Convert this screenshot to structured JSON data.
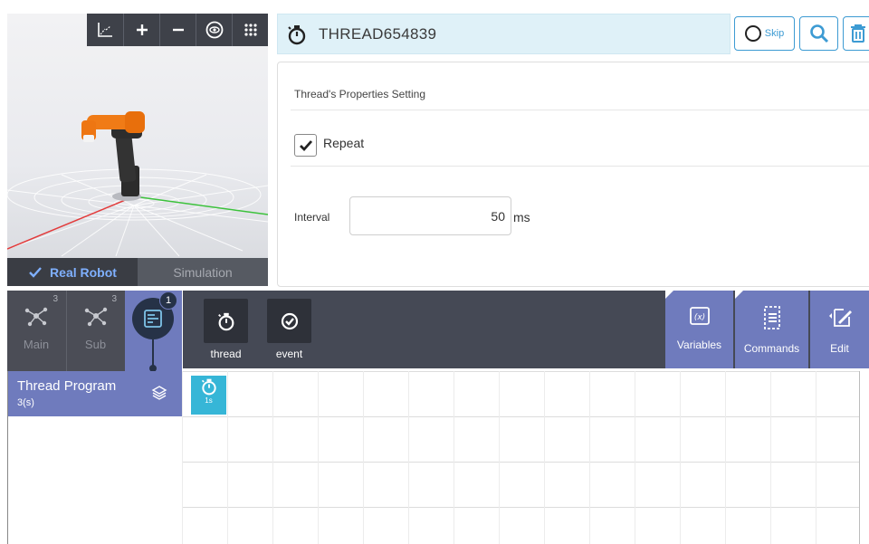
{
  "viewport": {
    "modes": {
      "real_robot": "Real Robot",
      "simulation": "Simulation"
    },
    "toolbar_icons": [
      "axes-icon",
      "zoom-in-icon",
      "zoom-out-icon",
      "eye-icon",
      "grid-dots-icon"
    ]
  },
  "header": {
    "title": "THREAD654839",
    "skip_label": "Skip",
    "icons": [
      "stopwatch-icon",
      "search-icon",
      "trash-icon"
    ]
  },
  "properties": {
    "section_title": "Thread's Properties Setting",
    "repeat_label": "Repeat",
    "repeat_checked": true,
    "interval_label": "Interval",
    "interval_value": "50",
    "interval_unit": "ms"
  },
  "program_tabs": {
    "main": {
      "label": "Main",
      "count": "3"
    },
    "sub": {
      "label": "Sub",
      "count": "3"
    },
    "thread": {
      "count": "1"
    }
  },
  "commands": {
    "thread_label": "thread",
    "event_label": "event",
    "variables_label": "Variables",
    "commands_label": "Commands",
    "edit_label": "Edit"
  },
  "thread_program": {
    "name": "Thread Program",
    "count": "3(s)",
    "node_time": "1s"
  },
  "colors": {
    "accent_purple": "#6f7bbd",
    "header_bg": "#dff1f8",
    "node_cyan": "#36b6d7",
    "dark_bar": "#454955",
    "link_blue": "#3d9bd3"
  }
}
